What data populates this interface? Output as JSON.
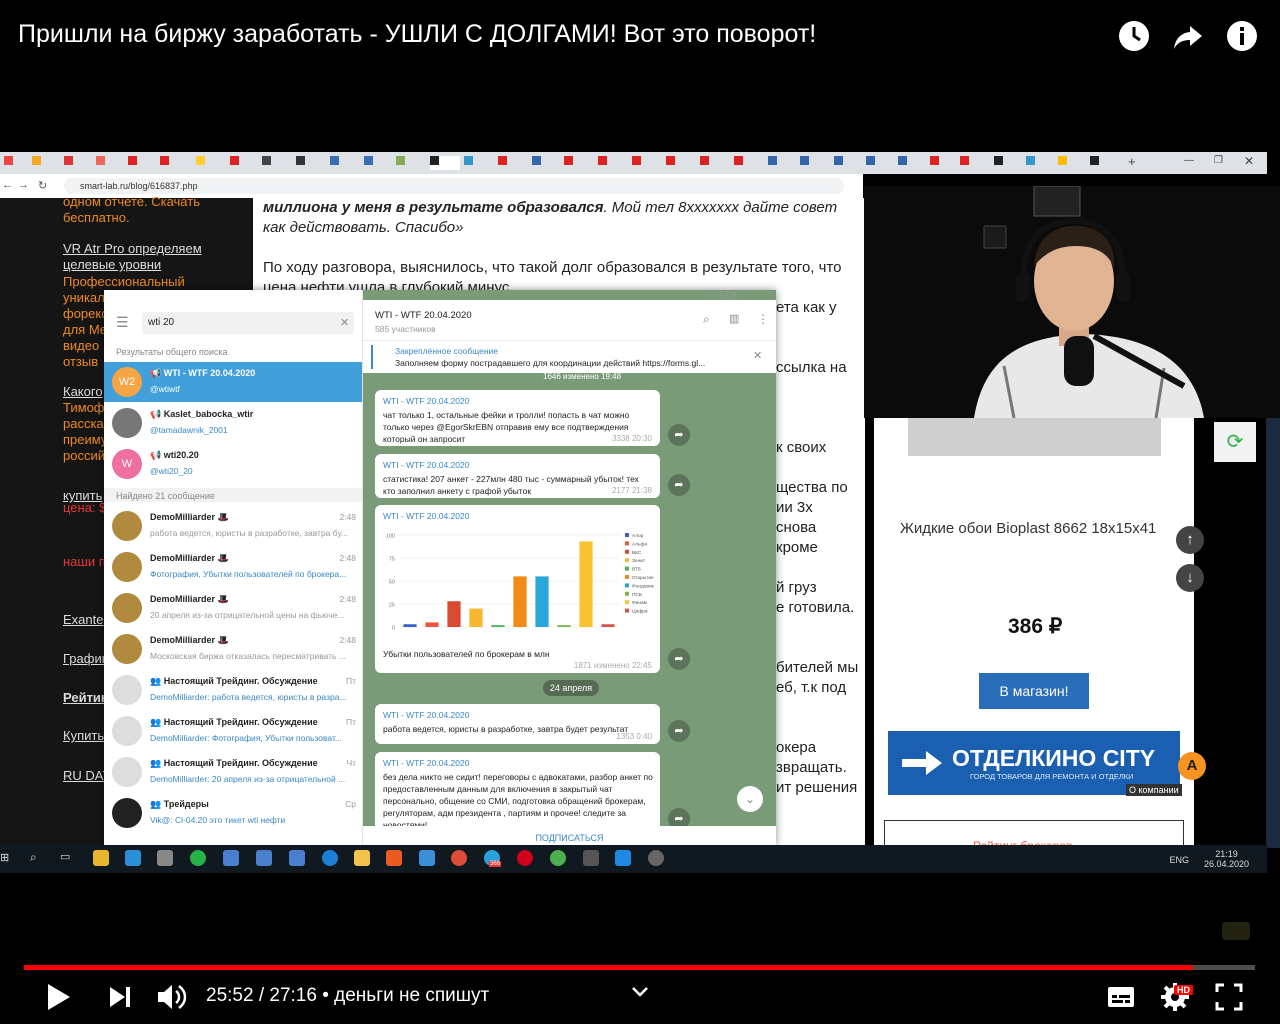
{
  "youtube": {
    "title": "Пришли на биржу заработать - УШЛИ С ДОЛГАМИ! Вот это поворот!",
    "time_current": "25:52",
    "time_total": "27:16",
    "chapter": "• деньги не спишут",
    "progress_fraction": 0.95,
    "icons": [
      "clock-icon",
      "share-icon",
      "info-icon",
      "play-icon",
      "next-icon",
      "volume-icon",
      "chevron-down-icon",
      "subtitles-icon",
      "settings-icon",
      "fullscreen-icon"
    ],
    "hd_badge": "HD"
  },
  "browser": {
    "url": "smart-lab.ru/blog/616837.php",
    "new_tab": "+"
  },
  "site_left": {
    "text_1": "одном отчете. Скачать бесплатно.",
    "link_1": "VR Atr Pro определяем целевые уровни",
    "text_2a": "Профессиональный",
    "text_2b": "уникал",
    "text_2c": "форекс",
    "text_2d": "для Ме",
    "text_2e": "видео",
    "text_2f": "отзыв",
    "link_2a": "Какого",
    "text_3a": "Тимоф",
    "text_3b": "расска",
    "text_3c": "преиму",
    "text_3d": "россий",
    "link_3": "купить",
    "text_4": "цена: $",
    "text_5": "наши п",
    "link_4": "Exante",
    "link_5": "График",
    "link_6": "Рейтин",
    "link_7": "Купить",
    "link_8": "RU DAT"
  },
  "article": {
    "p1_bold": "миллиона у меня в результате образовался",
    "p1_italic": ". Мой тел 8ххххххх дайте совет как действовать. Спасибо»",
    "p2": "По ходу разговора, выяснилось, что такой долг образовался в результате того, что цена нефти ушла в глубокий минус.",
    "f1": "ета как у",
    "f2": "ссылка на",
    "f3": "к своих",
    "f4": "щества по",
    "f5": "ии 3х",
    "f6": "снова",
    "f7": "кроме",
    "f8": "й груз",
    "f9": "е готовила.",
    "f10": "бителей мы",
    "f11": "еб, т.к под",
    "f12": "окера",
    "f13": "звращать.",
    "f14": "ит решения"
  },
  "telegram": {
    "search_value": "wti 20",
    "section_global": "Результаты общего поиска",
    "section_found": "Найдено 21 сообщение",
    "chats": [
      {
        "avatar": "W2",
        "name": "📢 WTI - WTF 20.04.2020",
        "sub": "@wtiwtf",
        "time": ""
      },
      {
        "avatar": "",
        "name": "📢 Kaslet_babocka_wtir",
        "sub": "@tamadawnik_2001",
        "time": ""
      },
      {
        "avatar": "W",
        "name": "📢 wti20.20",
        "sub": "@wti20_20",
        "time": ""
      }
    ],
    "messages_found": [
      {
        "name": "DemoMilliarder 🎩",
        "sub": "работа ведется, юристы в разработке, завтра бу...",
        "time": "2:48"
      },
      {
        "name": "DemoMilliarder 🎩",
        "sub": "Фотография, Убытки пользователей по брокера...",
        "time": "2:48"
      },
      {
        "name": "DemoMilliarder 🎩",
        "sub": "20 апреля из-за отрицательной цены на фьюче...",
        "time": "2:48"
      },
      {
        "name": "DemoMilliarder 🎩",
        "sub": "Московская биржа отказалась пересматривать ...",
        "time": "2:48"
      },
      {
        "name": "👥 Настоящий Трейдинг. Обсуждение",
        "sub": "DemoMilliarder: работа ведется, юристы в разра...",
        "time": "Пт"
      },
      {
        "name": "👥 Настоящий Трейдинг. Обсуждение",
        "sub": "DemoMilliarder: Фотография, Убытки пользоват...",
        "time": "Пт"
      },
      {
        "name": "👥 Настоящий Трейдинг. Обсуждение",
        "sub": "DemoMilliarder: 20 апреля из-за отрицательной ...",
        "time": "Чт"
      },
      {
        "name": "👥 Трейдеры",
        "sub": "Vik@: Cl-04.20 это тикет wti нефти",
        "time": "Ср"
      }
    ],
    "channel_title": "WTI - WTF 20.04.2020",
    "channel_members": "585 участников",
    "pinned_label": "Закреплённое сообщение",
    "pinned_text": "Заполняем форму пострадавшего для координации действий https://forms.gl...",
    "pinned_meta": "1646   изменено 19:48",
    "posts": [
      {
        "from": "WTI - WTF 20.04.2020",
        "text": "чат только 1, остальные фейки и тролли! попасть в чат можно только через @EgorSkrEBN отправив ему все подтверждения который он запросит",
        "meta": "3338   20:30"
      },
      {
        "from": "WTI - WTF 20.04.2020",
        "text": "статистика! 207 анкет - 227млн 480 тыс - суммарный убыток! тех кто заполнил анкету с графой убыток",
        "meta": "2177   21:38"
      },
      {
        "from": "WTI - WTF 20.04.2020",
        "text": "Убытки пользователей по брокерам в млн",
        "meta": "1871   изменено 22:45"
      },
      {
        "from": "WTI - WTF 20.04.2020",
        "text": "работа ведется, юристы в разработке,  завтра будет результат",
        "meta": "1353   0:40"
      },
      {
        "from": "WTI - WTF 20.04.2020",
        "text": "без дела никто не сидит! переговоры с адвокатами, разбор анкет по предоставленным данным для включения в закрытый чат персонально, общение со СМИ, подготовка обращений брокерам, регуляторам, адм президента , партиям и прочее! следите за новостями!",
        "meta": ""
      }
    ],
    "date_pill": "24 апреля",
    "subscribe": "ПОДПИСАТЬСЯ"
  },
  "chart_data": {
    "type": "bar",
    "title": "",
    "xlabel": "",
    "ylabel": "",
    "ylim": [
      0,
      100
    ],
    "yticks": [
      0,
      25,
      50,
      75,
      100
    ],
    "categories": [
      "Алор",
      "Альфа",
      "БКС",
      "Зенит",
      "ВТБ",
      "Открытие",
      "Фондовик",
      "ПСБ",
      "Финам",
      "Цифра"
    ],
    "values": [
      3,
      5,
      28,
      20,
      2,
      55,
      55,
      2,
      93,
      3
    ],
    "colors": [
      "#3b5fc9",
      "#e9573f",
      "#d94a32",
      "#f7b731",
      "#4ab45a",
      "#f28a16",
      "#2aa7d8",
      "#7ab648",
      "#f9c232",
      "#d9534f"
    ]
  },
  "ad": {
    "product": "Жидкие обои Bioplast 8662 18x15x41",
    "price": "386 ₽",
    "button": "В магазин!",
    "banner_title": "ОТДЕЛКИНО CITY",
    "banner_sub": "ГОРОД ТОВАРОВ ДЛЯ РЕМОНТА И ОТДЕЛКИ",
    "about": "О компании",
    "bottom_cut": "Рейтинг брокеров"
  },
  "taskbar": {
    "lang": "ENG",
    "clock_time": "21:19",
    "clock_date": "26.04.2020",
    "badge": "366"
  },
  "colors": {
    "youtube_red": "#ff0000",
    "telegram_blue": "#419fd9",
    "site_orange": "#f08a1e"
  }
}
